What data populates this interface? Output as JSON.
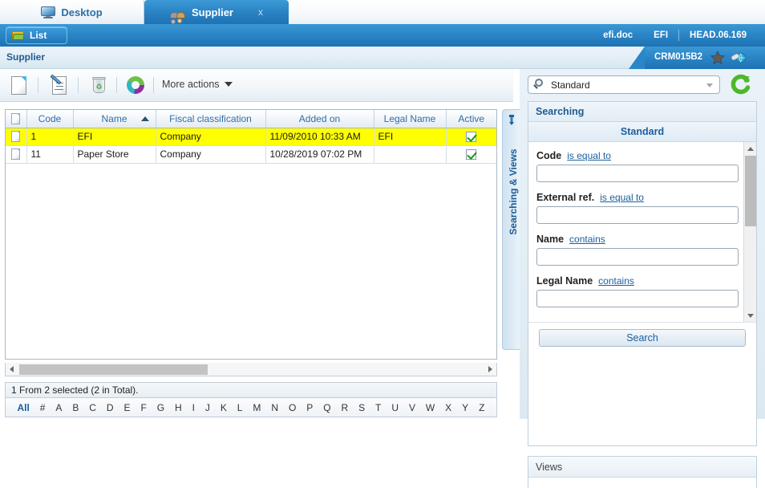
{
  "tabs": [
    {
      "label": "Desktop",
      "icon": "monitor-icon",
      "active": false,
      "closable": false
    },
    {
      "label": "Supplier",
      "icon": "people-icon",
      "active": true,
      "closable": true,
      "close_label": "x"
    }
  ],
  "banner": {
    "list_button": {
      "label": "List",
      "icon": "folder-icon"
    },
    "right_items": [
      "efi.doc",
      "EFI",
      "HEAD.06.169"
    ]
  },
  "breadcrumb": {
    "title": "Supplier",
    "badge": "CRM015B2",
    "star_icon": "star-icon",
    "globe_icon": "globe-icon"
  },
  "toolbar": {
    "items": [
      {
        "name": "new-record-button",
        "icon": "document-icon"
      },
      {
        "name": "edit-record-button",
        "icon": "document-pen-icon"
      },
      {
        "name": "delete-record-button",
        "icon": "trash-icon"
      },
      {
        "name": "refresh-button",
        "icon": "color-wheel-icon"
      }
    ],
    "more_actions_label": "More actions"
  },
  "grid": {
    "columns": [
      {
        "key": "selector",
        "label": ""
      },
      {
        "key": "code",
        "label": "Code"
      },
      {
        "key": "name",
        "label": "Name",
        "sorted": "asc"
      },
      {
        "key": "fiscal",
        "label": "Fiscal classification"
      },
      {
        "key": "added",
        "label": "Added on"
      },
      {
        "key": "legal",
        "label": "Legal Name"
      },
      {
        "key": "active",
        "label": "Active"
      }
    ],
    "rows": [
      {
        "selected": true,
        "code": "1",
        "name": "EFI",
        "fiscal": "Company",
        "added": "11/09/2010 10:33 AM",
        "legal": "EFI",
        "active": true
      },
      {
        "selected": false,
        "code": "11",
        "name": "Paper Store",
        "fiscal": "Company",
        "added": "10/28/2019 07:02 PM",
        "legal": "",
        "active": true
      }
    ]
  },
  "status": {
    "text": "1 From 2 selected (2 in Total)."
  },
  "alphabet": [
    "All",
    "#",
    "A",
    "B",
    "C",
    "D",
    "E",
    "F",
    "G",
    "H",
    "I",
    "J",
    "K",
    "L",
    "M",
    "N",
    "O",
    "P",
    "Q",
    "R",
    "S",
    "T",
    "U",
    "V",
    "W",
    "X",
    "Y",
    "Z"
  ],
  "sidetab": {
    "label": "Searching & Views",
    "pin_icon": "pin-icon"
  },
  "right_panel": {
    "search_select": {
      "value": "Standard",
      "icon": "magnifier-icon"
    },
    "refresh_icon": "refresh-green-icon",
    "searching_header": "Searching",
    "standard_header": "Standard",
    "fields": [
      {
        "name": "Code",
        "operator": "is equal to",
        "value": "",
        "placeholder": ""
      },
      {
        "name": "External ref.",
        "operator": "is equal to",
        "value": "",
        "placeholder": ""
      },
      {
        "name": "Name",
        "operator": "contains",
        "value": "",
        "placeholder": ""
      },
      {
        "name": "Legal Name",
        "operator": "contains",
        "value": "",
        "placeholder": ""
      }
    ],
    "search_button": "Search",
    "views_header": "Views"
  },
  "colors": {
    "accent_blue": "#2b86c7",
    "header_text": "#1d5c92",
    "row_selected": "#ffff00",
    "check_green": "#139a13"
  }
}
